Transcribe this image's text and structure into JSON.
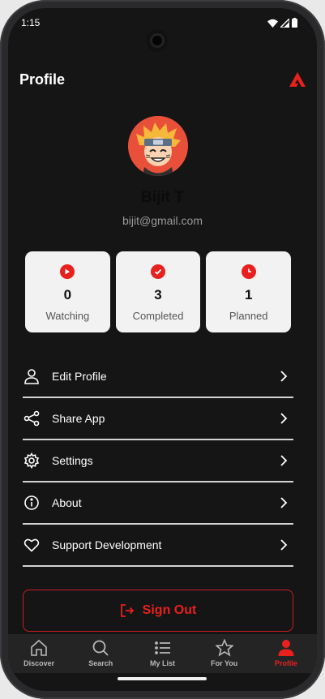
{
  "status_bar": {
    "time": "1:15"
  },
  "header": {
    "title": "Profile"
  },
  "user": {
    "name": "Bijit T",
    "email": "bijit@gmail.com"
  },
  "stats": [
    {
      "value": "0",
      "label": "Watching",
      "icon": "play-icon"
    },
    {
      "value": "3",
      "label": "Completed",
      "icon": "check-icon"
    },
    {
      "value": "1",
      "label": "Planned",
      "icon": "clock-icon"
    }
  ],
  "menu": [
    {
      "label": "Edit Profile",
      "icon": "user-icon"
    },
    {
      "label": "Share App",
      "icon": "share-icon"
    },
    {
      "label": "Settings",
      "icon": "gear-icon"
    },
    {
      "label": "About",
      "icon": "info-icon"
    },
    {
      "label": "Support Development",
      "icon": "heart-icon"
    }
  ],
  "sign_out": {
    "label": "Sign Out"
  },
  "nav": [
    {
      "label": "Discover",
      "icon": "home-icon"
    },
    {
      "label": "Search",
      "icon": "search-icon"
    },
    {
      "label": "My List",
      "icon": "list-icon"
    },
    {
      "label": "For You",
      "icon": "star-icon"
    },
    {
      "label": "Profile",
      "icon": "person-icon",
      "active": true
    }
  ],
  "colors": {
    "accent": "#e8201e",
    "background": "#151515",
    "card": "#f2f2f2"
  }
}
